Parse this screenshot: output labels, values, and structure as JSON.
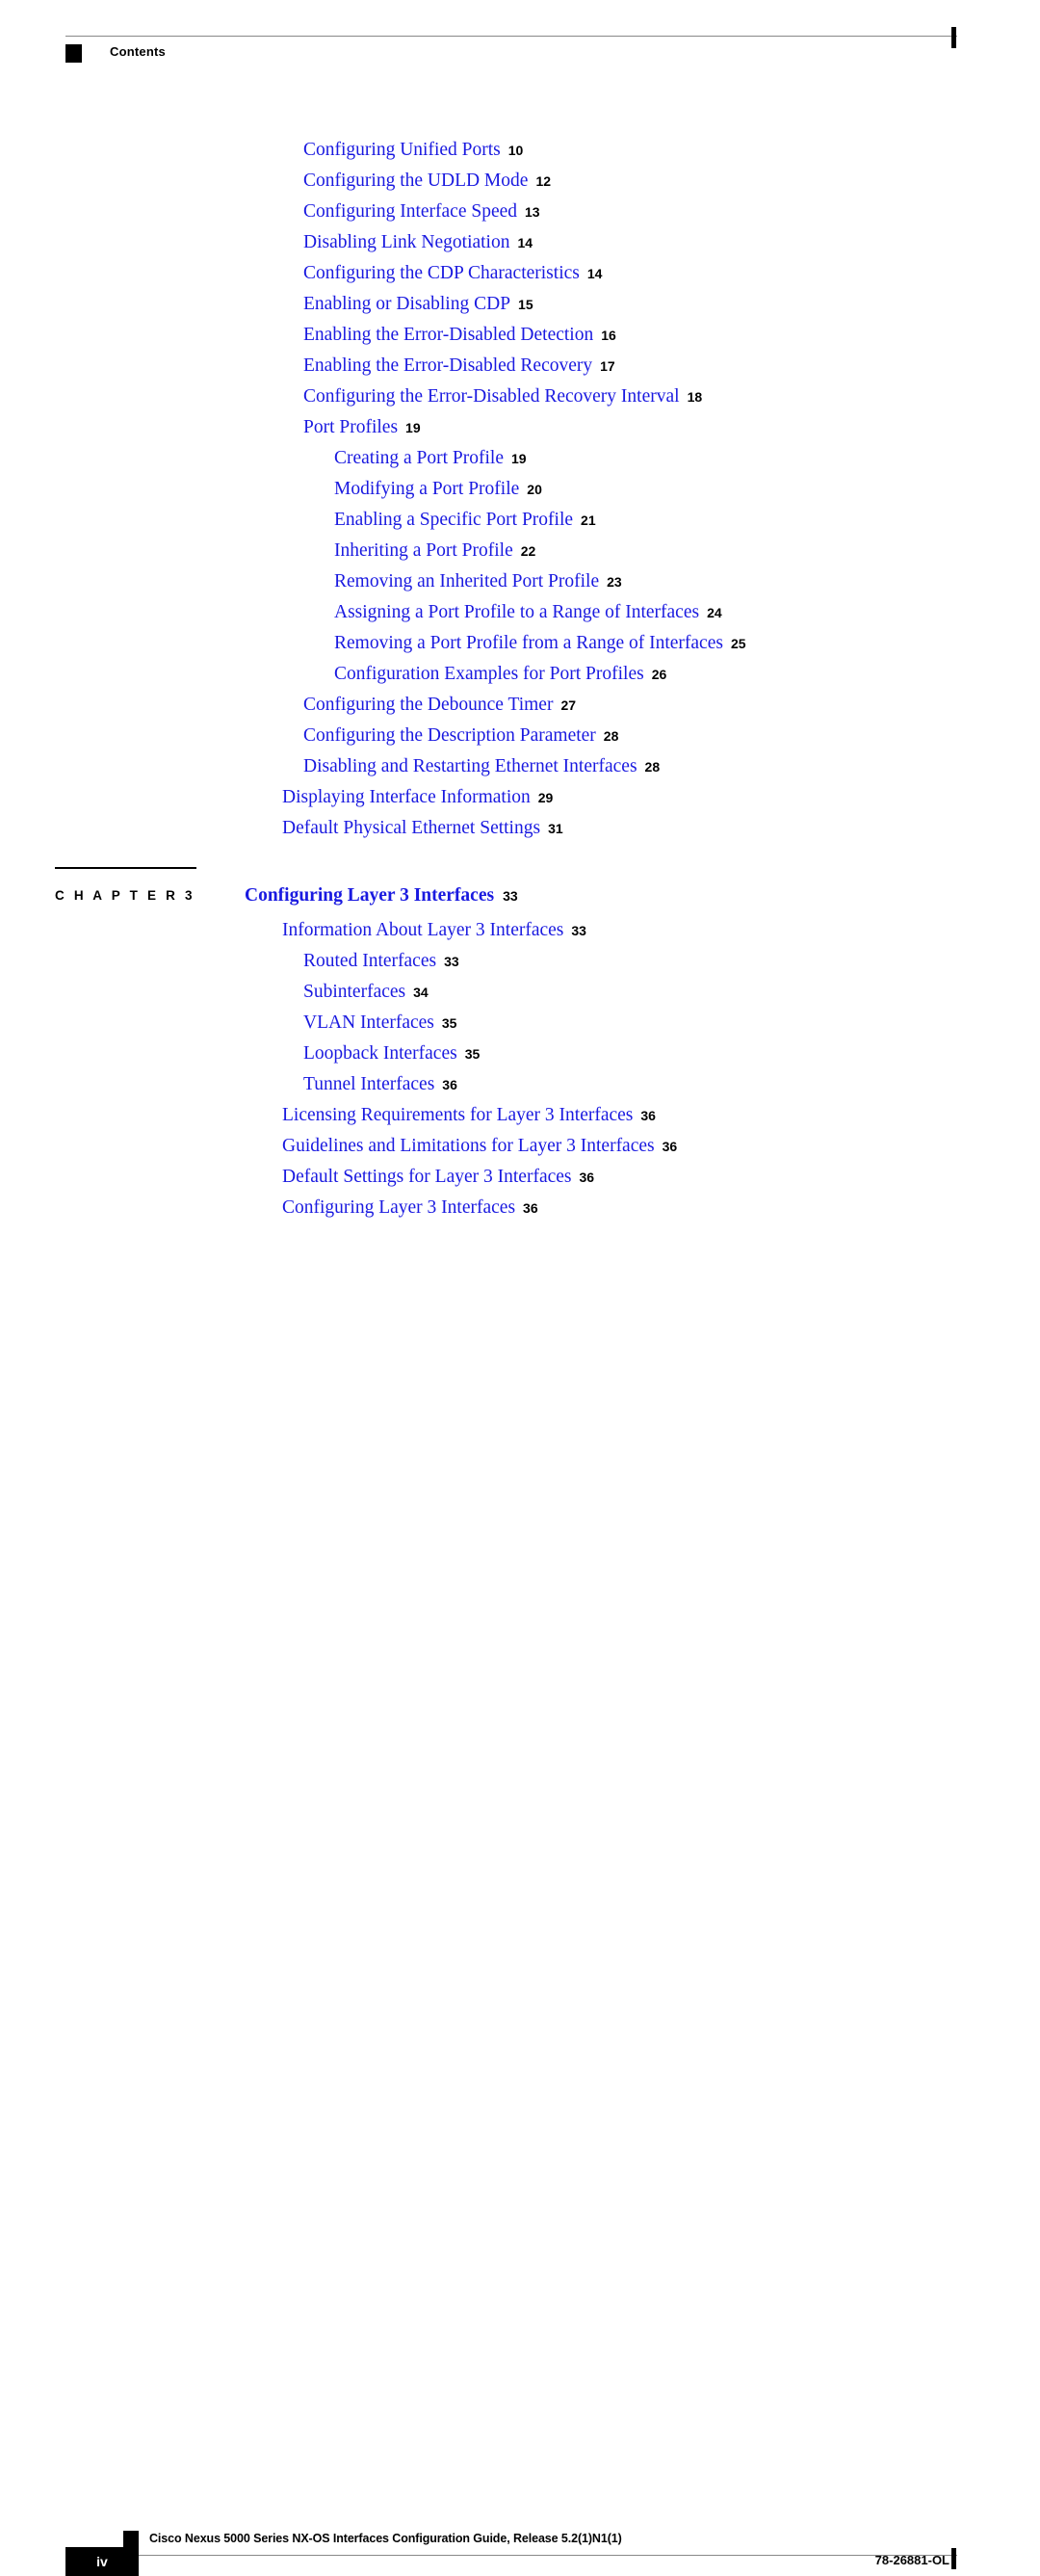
{
  "header": {
    "running_head": "Contents"
  },
  "colors": {
    "link_blue": "#1a1ae0",
    "page_number_black": "#000000"
  },
  "toc_before_chapter": [
    {
      "title": "Configuring Unified Ports",
      "page": "10",
      "level": 2
    },
    {
      "title": "Configuring the UDLD Mode",
      "page": "12",
      "level": 2
    },
    {
      "title": "Configuring Interface Speed",
      "page": "13",
      "level": 2
    },
    {
      "title": "Disabling Link Negotiation",
      "page": "14",
      "level": 2
    },
    {
      "title": "Configuring the CDP Characteristics",
      "page": "14",
      "level": 2
    },
    {
      "title": "Enabling or Disabling CDP",
      "page": "15",
      "level": 2
    },
    {
      "title": "Enabling the Error-Disabled Detection",
      "page": "16",
      "level": 2
    },
    {
      "title": "Enabling the Error-Disabled Recovery",
      "page": "17",
      "level": 2
    },
    {
      "title": "Configuring the Error-Disabled Recovery Interval",
      "page": "18",
      "level": 2
    },
    {
      "title": "Port Profiles",
      "page": "19",
      "level": 2
    },
    {
      "title": "Creating a Port Profile",
      "page": "19",
      "level": 3
    },
    {
      "title": "Modifying a Port Profile",
      "page": "20",
      "level": 3
    },
    {
      "title": "Enabling a Specific Port Profile",
      "page": "21",
      "level": 3
    },
    {
      "title": "Inheriting a Port Profile",
      "page": "22",
      "level": 3
    },
    {
      "title": "Removing an Inherited Port Profile",
      "page": "23",
      "level": 3
    },
    {
      "title": "Assigning a Port Profile to a Range of Interfaces",
      "page": "24",
      "level": 3
    },
    {
      "title": "Removing a Port Profile from a Range of Interfaces",
      "page": "25",
      "level": 3
    },
    {
      "title": "Configuration Examples for Port Profiles",
      "page": "26",
      "level": 3
    },
    {
      "title": "Configuring the Debounce Timer",
      "page": "27",
      "level": 2
    },
    {
      "title": "Configuring the Description Parameter",
      "page": "28",
      "level": 2
    },
    {
      "title": "Disabling and Restarting Ethernet Interfaces",
      "page": "28",
      "level": 2
    },
    {
      "title": "Displaying Interface Information",
      "page": "29",
      "level": 1
    },
    {
      "title": "Default Physical Ethernet Settings",
      "page": "31",
      "level": 1
    }
  ],
  "chapter": {
    "label": "C H A P T E R  3",
    "title": "Configuring Layer 3 Interfaces",
    "page": "33"
  },
  "toc_after_chapter": [
    {
      "title": "Information About Layer 3 Interfaces",
      "page": "33",
      "level": 1
    },
    {
      "title": "Routed Interfaces",
      "page": "33",
      "level": 2
    },
    {
      "title": "Subinterfaces",
      "page": "34",
      "level": 2
    },
    {
      "title": "VLAN Interfaces",
      "page": "35",
      "level": 2
    },
    {
      "title": "Loopback Interfaces",
      "page": "35",
      "level": 2
    },
    {
      "title": "Tunnel Interfaces",
      "page": "36",
      "level": 2
    },
    {
      "title": "Licensing Requirements for Layer 3 Interfaces",
      "page": "36",
      "level": 1
    },
    {
      "title": "Guidelines and Limitations for Layer 3 Interfaces",
      "page": "36",
      "level": 1
    },
    {
      "title": "Default Settings for Layer 3 Interfaces",
      "page": "36",
      "level": 1
    },
    {
      "title": "Configuring Layer 3 Interfaces",
      "page": "36",
      "level": 1
    }
  ],
  "footer": {
    "book_title": "Cisco Nexus 5000 Series NX-OS Interfaces Configuration Guide, Release 5.2(1)N1(1)",
    "page_number": "iv",
    "document_number": "78-26881-OL"
  }
}
